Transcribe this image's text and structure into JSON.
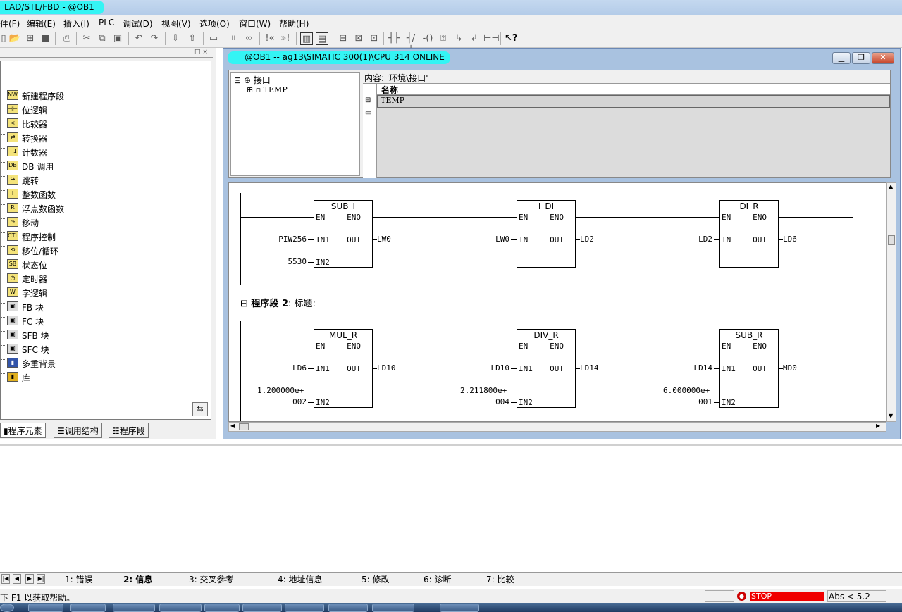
{
  "window": {
    "title": "LAD/STL/FBD  - @OB1"
  },
  "menu": [
    "件(F)",
    "编辑(E)",
    "插入(I)",
    "PLC",
    "调试(D)",
    "视图(V)",
    "选项(O)",
    "窗口(W)",
    "帮助(H)"
  ],
  "left_panel": {
    "items": [
      {
        "label": "新建程序段",
        "icon": "new-network-icon"
      },
      {
        "label": "位逻辑",
        "icon": "bit-logic-icon"
      },
      {
        "label": "比较器",
        "icon": "comparator-icon"
      },
      {
        "label": "转换器",
        "icon": "converter-icon"
      },
      {
        "label": "计数器",
        "icon": "counter-icon"
      },
      {
        "label": "DB 调用",
        "icon": "db-call-icon"
      },
      {
        "label": "跳转",
        "icon": "jump-icon"
      },
      {
        "label": "整数函数",
        "icon": "integer-function-icon"
      },
      {
        "label": "浮点数函数",
        "icon": "float-function-icon"
      },
      {
        "label": "移动",
        "icon": "move-icon"
      },
      {
        "label": "程序控制",
        "icon": "program-control-icon"
      },
      {
        "label": "移位/循环",
        "icon": "shift-rotate-icon"
      },
      {
        "label": "状态位",
        "icon": "status-bit-icon"
      },
      {
        "label": "定时器",
        "icon": "timer-icon"
      },
      {
        "label": "字逻辑",
        "icon": "word-logic-icon"
      },
      {
        "label": "FB 块",
        "icon": "fb-block-icon"
      },
      {
        "label": "FC 块",
        "icon": "fc-block-icon"
      },
      {
        "label": "SFB 块",
        "icon": "sfb-block-icon"
      },
      {
        "label": "SFC 块",
        "icon": "sfc-block-icon"
      },
      {
        "label": "多重背景",
        "icon": "multi-instance-icon"
      },
      {
        "label": "库",
        "icon": "library-icon"
      }
    ],
    "tabs": [
      "程序元素",
      "调用结构",
      "程序段"
    ]
  },
  "editor": {
    "title": "@OB1 -- ag13\\SIMATIC 300(1)\\CPU 314  ONLINE",
    "interface": {
      "root": "接口",
      "child": "TEMP",
      "content_label": "内容:  '环境\\接口'",
      "column_name": "名称",
      "row_value": "TEMP"
    },
    "networks": [
      {
        "blocks": [
          {
            "name": "SUB_I",
            "en": "EN",
            "eno": "ENO",
            "in1_pin": "IN1",
            "in2_pin": "IN2",
            "out_pin": "OUT",
            "in1": "PIW256",
            "in2": "5530",
            "out": "LW0"
          },
          {
            "name": "I_DI",
            "en": "EN",
            "eno": "ENO",
            "in1_pin": "IN",
            "out_pin": "OUT",
            "in1": "LW0",
            "out": "LD2"
          },
          {
            "name": "DI_R",
            "en": "EN",
            "eno": "ENO",
            "in1_pin": "IN",
            "out_pin": "OUT",
            "in1": "LD2",
            "out": "LD6"
          }
        ]
      },
      {
        "header_num": "程序段  2",
        "header_title": ": 标题:",
        "blocks": [
          {
            "name": "MUL_R",
            "en": "EN",
            "eno": "ENO",
            "in1_pin": "IN1",
            "in2_pin": "IN2",
            "out_pin": "OUT",
            "in1": "LD6",
            "in2a": "1.200000e+",
            "in2b": "002",
            "out": "LD10"
          },
          {
            "name": "DIV_R",
            "en": "EN",
            "eno": "ENO",
            "in1_pin": "IN1",
            "in2_pin": "IN2",
            "out_pin": "OUT",
            "in1": "LD10",
            "in2a": "2.211800e+",
            "in2b": "004",
            "out": "LD14"
          },
          {
            "name": "SUB_R",
            "en": "EN",
            "eno": "ENO",
            "in1_pin": "IN1",
            "in2_pin": "IN2",
            "out_pin": "OUT",
            "in1": "LD14",
            "in2a": "6.000000e+",
            "in2b": "001",
            "out": "MD0"
          }
        ]
      }
    ]
  },
  "output_tabs": [
    "1: 错误",
    "2: 信息",
    "3: 交叉参考",
    "4: 地址信息",
    "5: 修改",
    "6: 诊断",
    "7: 比较"
  ],
  "status": {
    "help": "下 F1 以获取帮助。",
    "mode": "STOP",
    "abs": "Abs < 5.2"
  },
  "colors": {
    "highlight": "#34f4f4",
    "stop": "#f00000"
  }
}
